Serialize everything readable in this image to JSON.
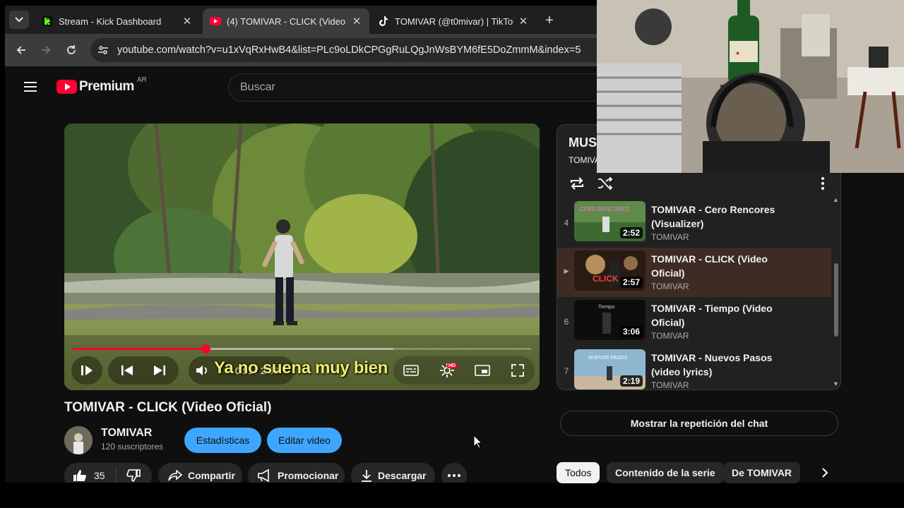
{
  "browser": {
    "tabs": [
      {
        "title": "Stream - Kick Dashboard",
        "favicon": "kick-icon",
        "color": "#53fc18"
      },
      {
        "title": "(4) TOMIVAR - CLICK (Video Oficial)",
        "favicon": "youtube-icon",
        "color": "#ff0033"
      },
      {
        "title": "TOMIVAR (@t0mivar) | TikTok",
        "favicon": "tiktok-icon",
        "color": "#ffffff"
      }
    ],
    "active_tab": 1,
    "url": "youtube.com/watch?v=u1xVqRxHwB4&list=PLc9oLDkCPGgRuLQgJnWsBYM6fE5DoZmmM&index=5"
  },
  "youtube": {
    "brand": "Premium",
    "country": "AR",
    "search_placeholder": "Buscar",
    "player": {
      "current_time": "0:51",
      "duration": "2:56",
      "time_display": "0:51 / 2:56",
      "progress": 0.29,
      "buffered": 0.7,
      "subtitle": "Ya no suena muy bien",
      "hd_badge": "HD"
    },
    "video": {
      "title": "TOMIVAR - CLICK (Video Oficial)",
      "channel": "TOMIVAR",
      "subscribers": "120 suscriptores",
      "likes": "35",
      "actions": {
        "stats": "Estadísticas",
        "edit": "Editar video",
        "share": "Compartir",
        "promote": "Promocionar",
        "download": "Descargar"
      }
    },
    "playlist": {
      "title": "MUS",
      "owner": "TOMIVAR",
      "items": [
        {
          "index": "4",
          "title": "TOMIVAR - Cero Rencores (Visualizer)",
          "owner": "TOMIVAR",
          "duration": "2:52",
          "thumb_text": "CERO RENCORES"
        },
        {
          "index": "▶",
          "title": "TOMIVAR - CLICK (Video Oficial)",
          "owner": "TOMIVAR",
          "duration": "2:57",
          "thumb_text": "CLICK"
        },
        {
          "index": "6",
          "title": "TOMIVAR - Tiempo (Video Oficial)",
          "owner": "TOMIVAR",
          "duration": "3:06",
          "thumb_text": "Tiempo"
        },
        {
          "index": "7",
          "title": "TOMIVAR - Nuevos Pasos (video lyrics)",
          "owner": "TOMIVAR",
          "duration": "2:19",
          "thumb_text": "NUEVOS PASOS"
        }
      ]
    },
    "chat_replay": "Mostrar la repetición del chat",
    "chips": [
      "Todos",
      "Contenido de la serie",
      "De TOMIVAR"
    ]
  }
}
